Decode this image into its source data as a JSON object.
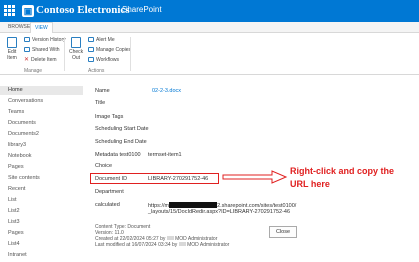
{
  "suite_bar": {
    "logo_text": "Contoso Electronics",
    "logo_glyph": "▣",
    "app_name": "SharePoint"
  },
  "ribbon": {
    "tabs": [
      "BROWSE",
      "VIEW"
    ],
    "buttons": {
      "edit_item": "Edit Item",
      "version_history": "Version History",
      "shared_with": "Shared With",
      "delete_item": "Delete Item",
      "check_out": "Check Out",
      "alert_me": "Alert Me",
      "manage_copies": "Manage Copies",
      "workflows": "Workflows"
    },
    "groups": {
      "manage": "Manage",
      "actions": "Actions"
    }
  },
  "sidebar": {
    "items": [
      "Home",
      "Conversations",
      "Teams",
      "Documents",
      "Documents2",
      "library3",
      "Notebook",
      "Pages",
      "Site contents",
      "Recent",
      "List",
      "List2",
      "List3",
      "Pages",
      "List4",
      "Intranet"
    ]
  },
  "properties": [
    {
      "label": "Name",
      "value": "02-2-3.docx"
    },
    {
      "label": "Title",
      "value": ""
    },
    {
      "label": "Image Tags",
      "value": ""
    },
    {
      "label": "Scheduling Start Date",
      "value": ""
    },
    {
      "label": "Scheduling End Date",
      "value": ""
    },
    {
      "label": "Metadata test0100",
      "value": "termset-item1"
    },
    {
      "label": "Choice",
      "value": ""
    },
    {
      "label": "Document ID",
      "value": "LIBRARY-270291752-46"
    },
    {
      "label": "Department",
      "value": ""
    },
    {
      "label": "calculated",
      "value_prefix": "https://m",
      "value_suffix": "2.sharepoint.com/sites/test0100/",
      "value_line2": "_layouts/15/DocIdRedir.aspx?ID=LIBRARY-270291752-46"
    }
  ],
  "footer_meta": {
    "content_type": "Content Type: Document",
    "version": "Version: 11.0",
    "created": "Created at 22/02/2024 05:27",
    "created_by": "by",
    "created_user": "MOD Administrator",
    "modified": "Last modified at 16/07/2024 03:34",
    "modified_by": "by",
    "modified_user": "MOD Administrator"
  },
  "close_button": "Close",
  "annotation": {
    "text": "Right-click and copy the URL here",
    "color": "#e02020"
  },
  "colors": {
    "brand": "#0078d4",
    "highlight": "#e02020"
  }
}
